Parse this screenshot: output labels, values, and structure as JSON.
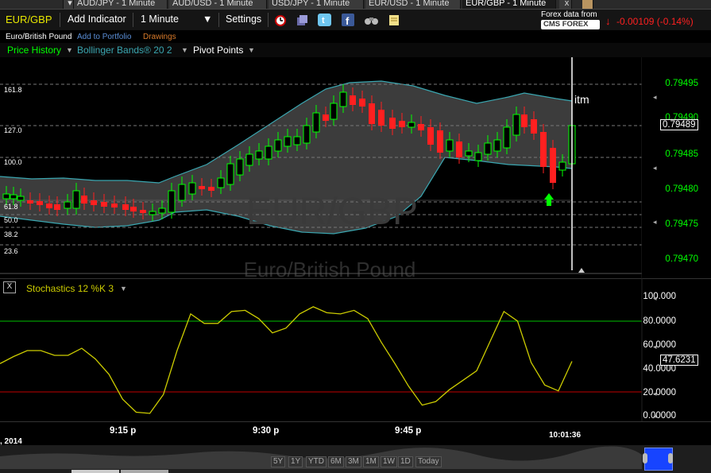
{
  "tabs": [
    {
      "label": "AUD/JPY - 1 Minute",
      "active": false
    },
    {
      "label": "AUD/USD - 1 Minute",
      "active": false
    },
    {
      "label": "USD/JPY - 1 Minute",
      "active": false
    },
    {
      "label": "EUR/USD - 1 Minute",
      "active": false
    },
    {
      "label": "EUR/GBP - 1 Minute",
      "active": true
    }
  ],
  "toolbar": {
    "symbol": "EUR/GBP",
    "add_indicator": "Add Indicator",
    "interval": "1 Minute",
    "settings": "Settings",
    "forex_label": "Forex data from",
    "provider": "CMS FOREX",
    "change": "-0.00109 (-0.14%)"
  },
  "subbar": {
    "name": "Euro/British Pound",
    "add_portfolio": "Add to Portfolio",
    "drawings": "Drawings"
  },
  "indicators": {
    "price_history": "Price History",
    "bollinger": "Bollinger Bands® 20 2",
    "pivot": "Pivot Points"
  },
  "watermark": {
    "symbol": "EUR/GBP",
    "name": "Euro/British Pound"
  },
  "annotation": "itm",
  "price_axis": {
    "labels": [
      "0.79495",
      "0.79490",
      "0.79485",
      "0.79480",
      "0.79475",
      "0.79470"
    ],
    "current": "0.79489"
  },
  "fib_labels": [
    "161.8",
    "127.0",
    "100.0",
    "61.8",
    "50.0",
    "38.2",
    "23.6"
  ],
  "stochastics": {
    "title": "Stochastics 12 %K 3",
    "axis": [
      "100.000",
      "80.0000",
      "60.0000",
      "40.0000",
      "20.0000",
      "0.00000"
    ],
    "current": "47.6231",
    "values": [
      44,
      50,
      55,
      55,
      51,
      51,
      57,
      48,
      35,
      14,
      3,
      2,
      18,
      55,
      86,
      78,
      78,
      88,
      89,
      82,
      70,
      74,
      86,
      92,
      87,
      86,
      89,
      82,
      62,
      44,
      25,
      9,
      12,
      22,
      30,
      38,
      63,
      88,
      80,
      45,
      26,
      21,
      46
    ]
  },
  "time_axis": {
    "labels": [
      "9:15 p",
      "9:30 p",
      "9:45 p"
    ],
    "cursor": "10:01:36",
    "date": ", 2014"
  },
  "range_buttons": [
    "5Y",
    "1Y",
    "YTD",
    "6M",
    "3M",
    "1M",
    "1W",
    "1D",
    "Today"
  ],
  "colors": {
    "up": "#00ff00",
    "down": "#ff2020",
    "stoch": "#cccc00",
    "band": "#3aa6b0"
  }
}
